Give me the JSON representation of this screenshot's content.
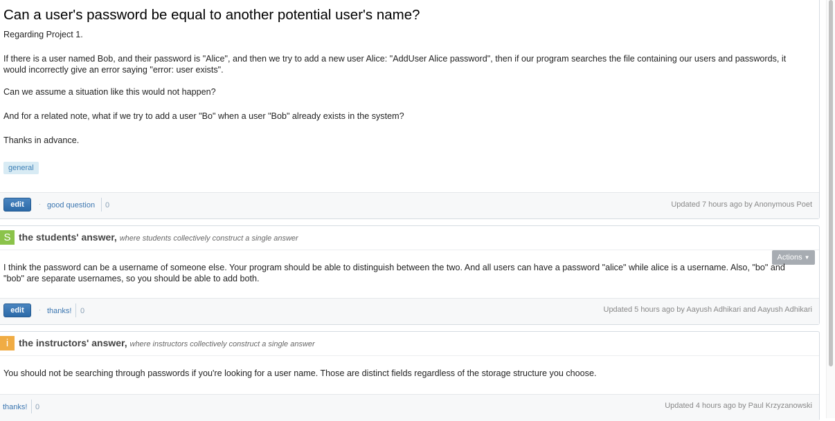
{
  "question": {
    "title": "Can a user's password be equal to another potential user's name?",
    "paragraphs": [
      "Regarding Project 1.",
      "If there is a user named Bob, and their password is \"Alice\", and then we try to add a new user Alice: \"AddUser Alice password\", then if our program searches the file containing our users and passwords, it would incorrectly give an error saying \"error: user exists\".",
      "Can we assume a situation like this would not happen?",
      "And for a related note, what if we try to add a user \"Bo\" when a user \"Bob\" already exists in the system?",
      "Thanks in advance."
    ],
    "tag": "general",
    "edit_label": "edit",
    "good_question_label": "good question",
    "good_question_count": "0",
    "updated": "Updated 7 hours ago by Anonymous Poet"
  },
  "students_answer": {
    "badge": "S",
    "title": "the students' answer,",
    "subtitle": "where students collectively construct a single answer",
    "actions_label": "Actions",
    "body": "I think the password can be a username of someone else. Your program should be able to distinguish between the two. And all users can have a password \"alice\" while alice is a username. Also, \"bo\" and \"bob\" are separate usernames, so you should be able to add both.",
    "edit_label": "edit",
    "thanks_label": "thanks!",
    "thanks_count": "0",
    "updated": "Updated 5 hours ago by Aayush Adhikari and Aayush Adhikari"
  },
  "instructors_answer": {
    "badge": "i",
    "title": "the instructors' answer,",
    "subtitle": "where instructors collectively construct a single answer",
    "body": "You should not be searching through passwords if you're looking for a user name. Those are distinct fields regardless of the storage structure you choose.",
    "thanks_label": "thanks!",
    "thanks_count": "0",
    "updated": "Updated 4 hours ago by Paul Krzyzanowski"
  },
  "colors": {
    "students_badge": "#8bc34a",
    "instructors_badge": "#f0ac44",
    "edit_button": "#2c6aa8",
    "tag_bg": "#d8ebf4"
  }
}
